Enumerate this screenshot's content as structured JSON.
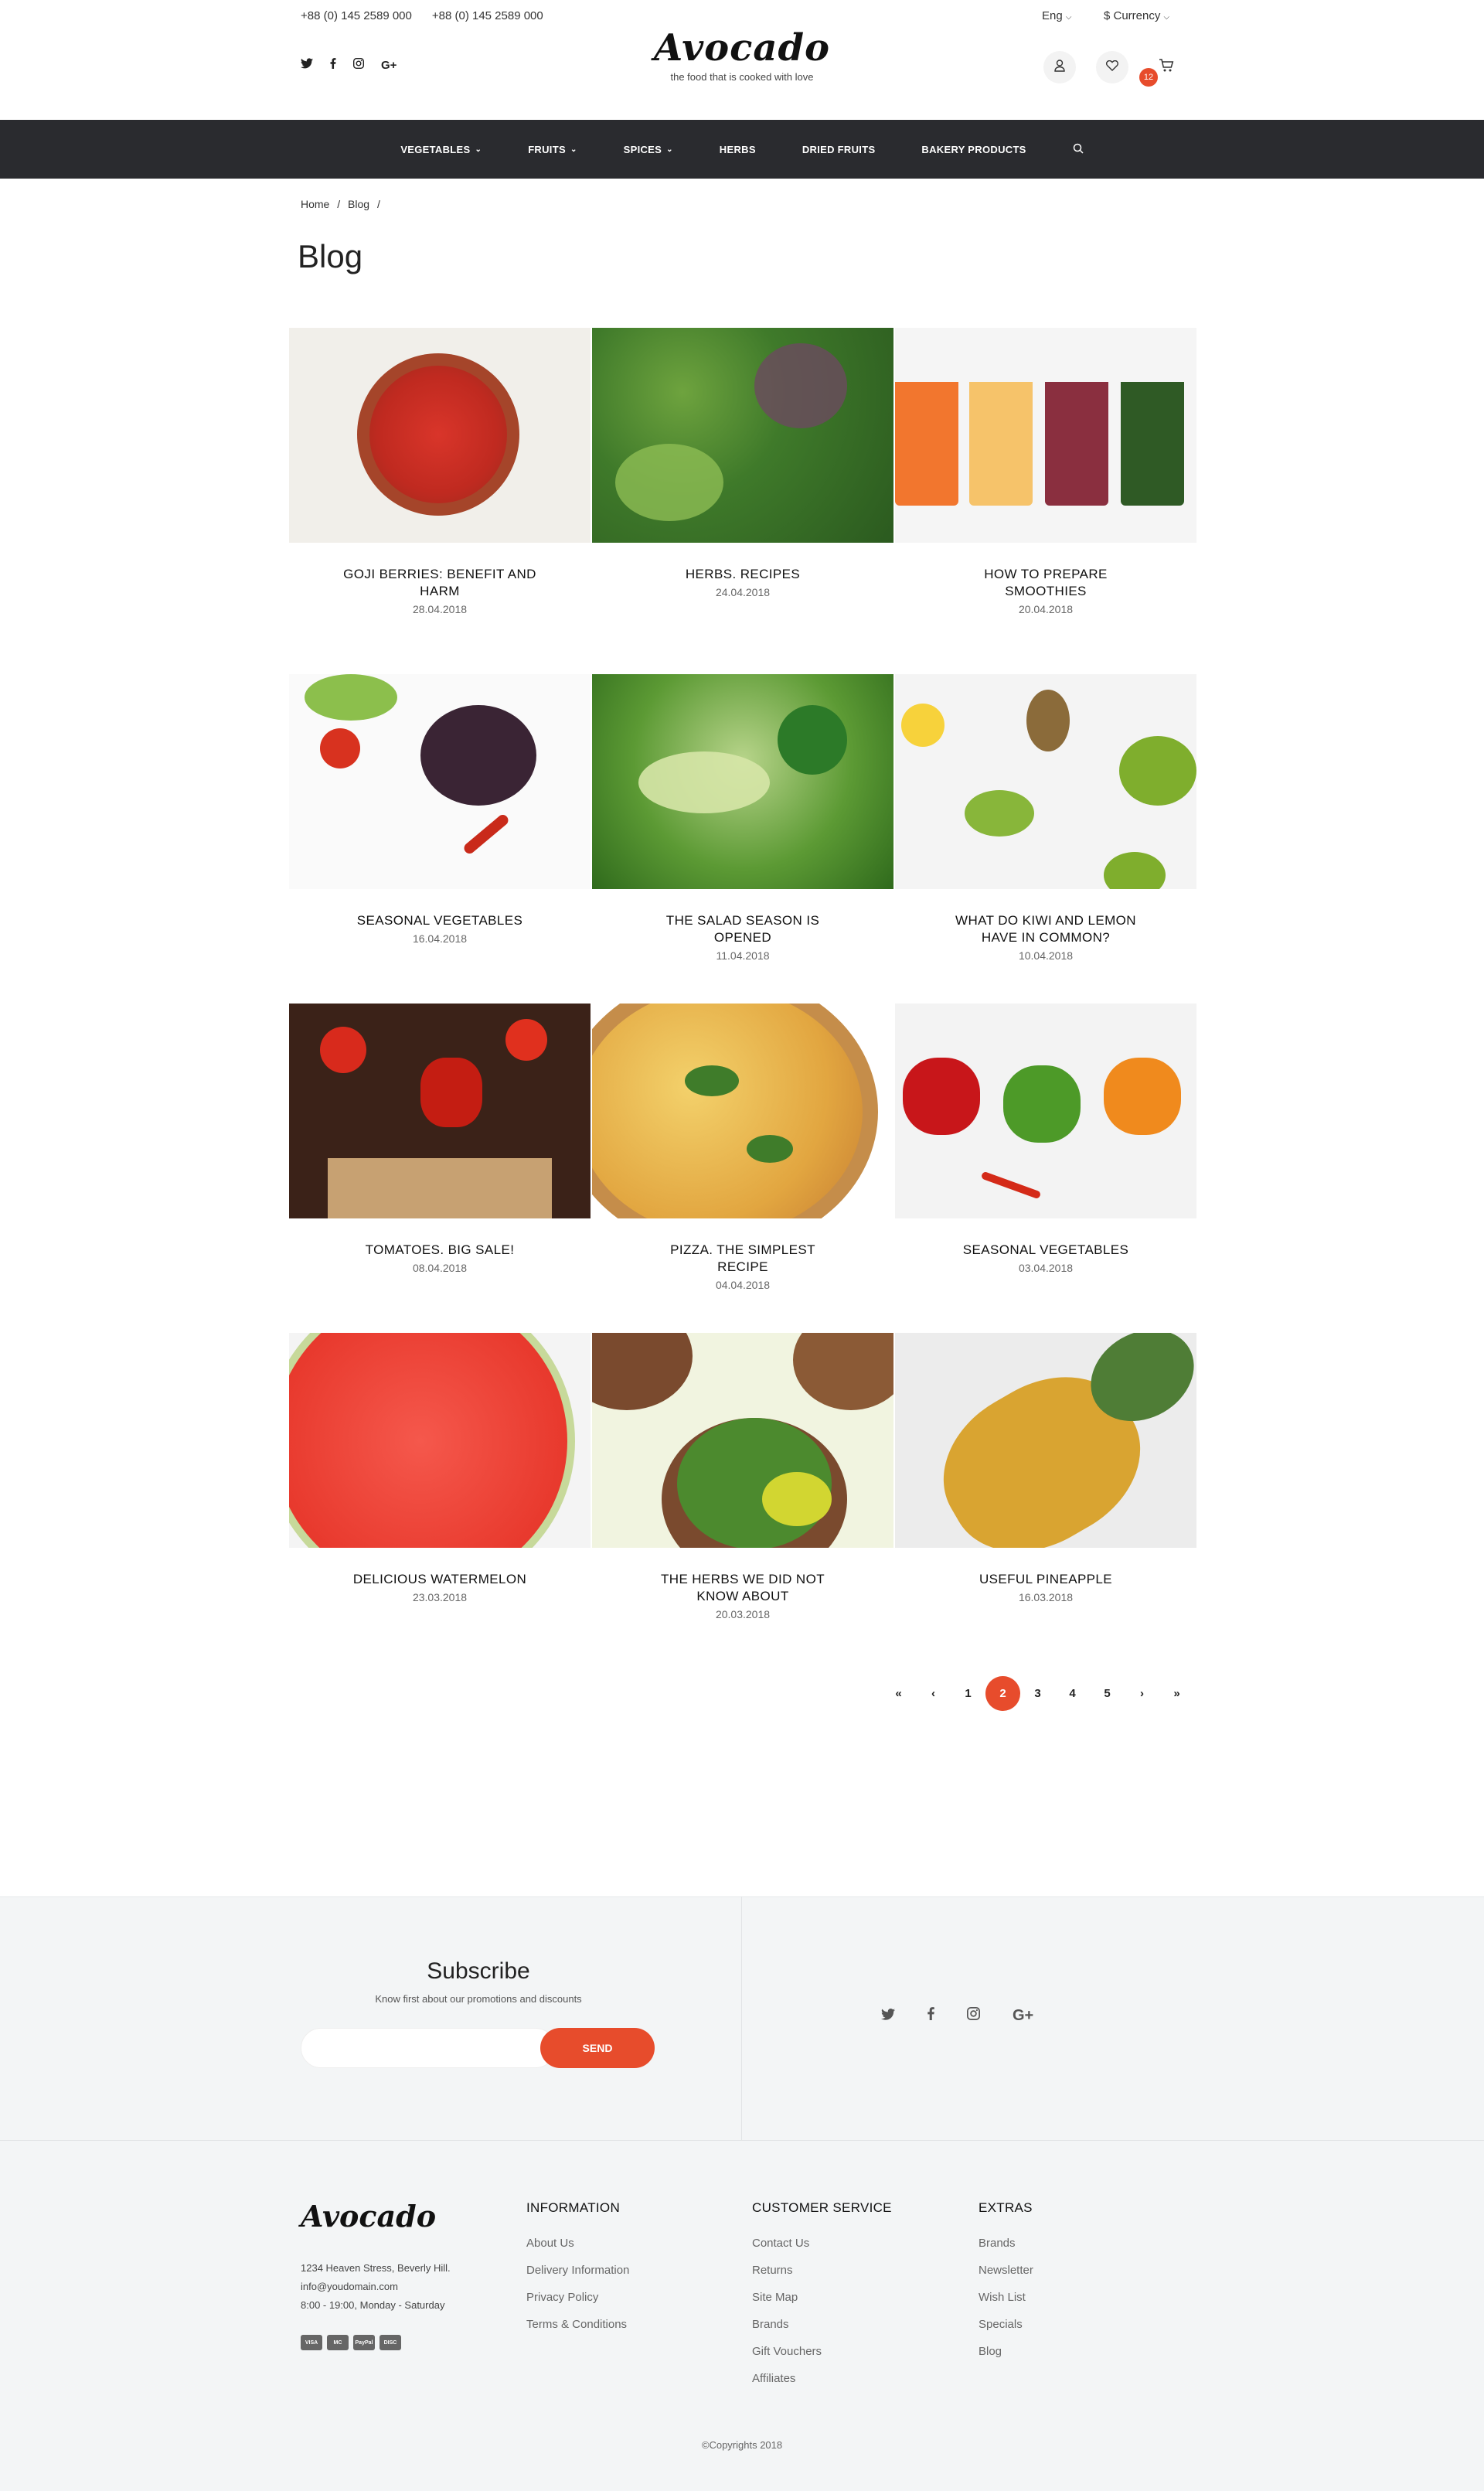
{
  "header": {
    "phones": [
      "+88 (0) 145 2589 000",
      "+88 (0) 145 2589 000"
    ],
    "logo": "Avocado",
    "tagline": "the food that is cooked with love",
    "language": "Eng",
    "currency": "$ Currency",
    "cart_count": "12"
  },
  "nav": {
    "items": [
      {
        "label": "VEGETABLES",
        "dropdown": true
      },
      {
        "label": "FRUITS",
        "dropdown": true
      },
      {
        "label": "SPICES",
        "dropdown": true
      },
      {
        "label": "HERBS",
        "dropdown": false
      },
      {
        "label": "DRIED FRUITS",
        "dropdown": false
      },
      {
        "label": "BAKERY PRODUCTS",
        "dropdown": false
      }
    ]
  },
  "breadcrumb": {
    "home": "Home",
    "current": "Blog"
  },
  "page_title": "Blog",
  "posts": [
    {
      "title": "GOJI BERRIES: BENEFIT AND HARM",
      "date": "28.04.2018"
    },
    {
      "title": "HERBS. RECIPES",
      "date": "24.04.2018"
    },
    {
      "title": "HOW TO PREPARE SMOOTHIES",
      "date": "20.04.2018"
    },
    {
      "title": "SEASONAL VEGETABLES",
      "date": "16.04.2018"
    },
    {
      "title": "THE SALAD SEASON IS OPENED",
      "date": "11.04.2018"
    },
    {
      "title": "WHAT DO KIWI AND LEMON HAVE IN COMMON?",
      "date": "10.04.2018"
    },
    {
      "title": "TOMATOES. BIG SALE!",
      "date": "08.04.2018"
    },
    {
      "title": "PIZZA. THE SIMPLEST RECIPE",
      "date": "04.04.2018"
    },
    {
      "title": "SEASONAL VEGETABLES",
      "date": "03.04.2018"
    },
    {
      "title": "DELICIOUS WATERMELON",
      "date": "23.03.2018"
    },
    {
      "title": "THE HERBS WE DID NOT KNOW ABOUT",
      "date": "20.03.2018"
    },
    {
      "title": "USEFUL PINEAPPLE",
      "date": "16.03.2018"
    }
  ],
  "pagination": {
    "first": "«",
    "prev": "‹",
    "pages": [
      "1",
      "2",
      "3",
      "4",
      "5"
    ],
    "current": "2",
    "next": "›",
    "last": "»"
  },
  "subscribe": {
    "title": "Subscribe",
    "text": "Know first about our promotions and discounts",
    "button": "SEND"
  },
  "footer": {
    "logo": "Avocado",
    "address": "1234 Heaven Stress, Beverly Hill.",
    "email": "info@youdomain.com",
    "hours": "8:00 - 19:00, Monday - Saturday",
    "payment_cards": [
      "VISA",
      "MC",
      "PayPal",
      "DISC"
    ],
    "columns": [
      {
        "title": "INFORMATION",
        "links": [
          "About Us",
          "Delivery Information",
          "Privacy Policy",
          "Terms & Conditions"
        ]
      },
      {
        "title": "CUSTOMER SERVICE",
        "links": [
          "Contact Us",
          "Returns",
          "Site Map",
          "Brands",
          "Gift Vouchers",
          "Affiliates"
        ]
      },
      {
        "title": "EXTRAS",
        "links": [
          "Brands",
          "Newsletter",
          "Wish List",
          "Specials",
          "Blog"
        ]
      }
    ],
    "copyright": "©Copyrights 2018"
  },
  "colors": {
    "accent": "#e74c2c",
    "nav_bg": "#2a2b2f",
    "footer_bg": "#f3f5f6"
  }
}
